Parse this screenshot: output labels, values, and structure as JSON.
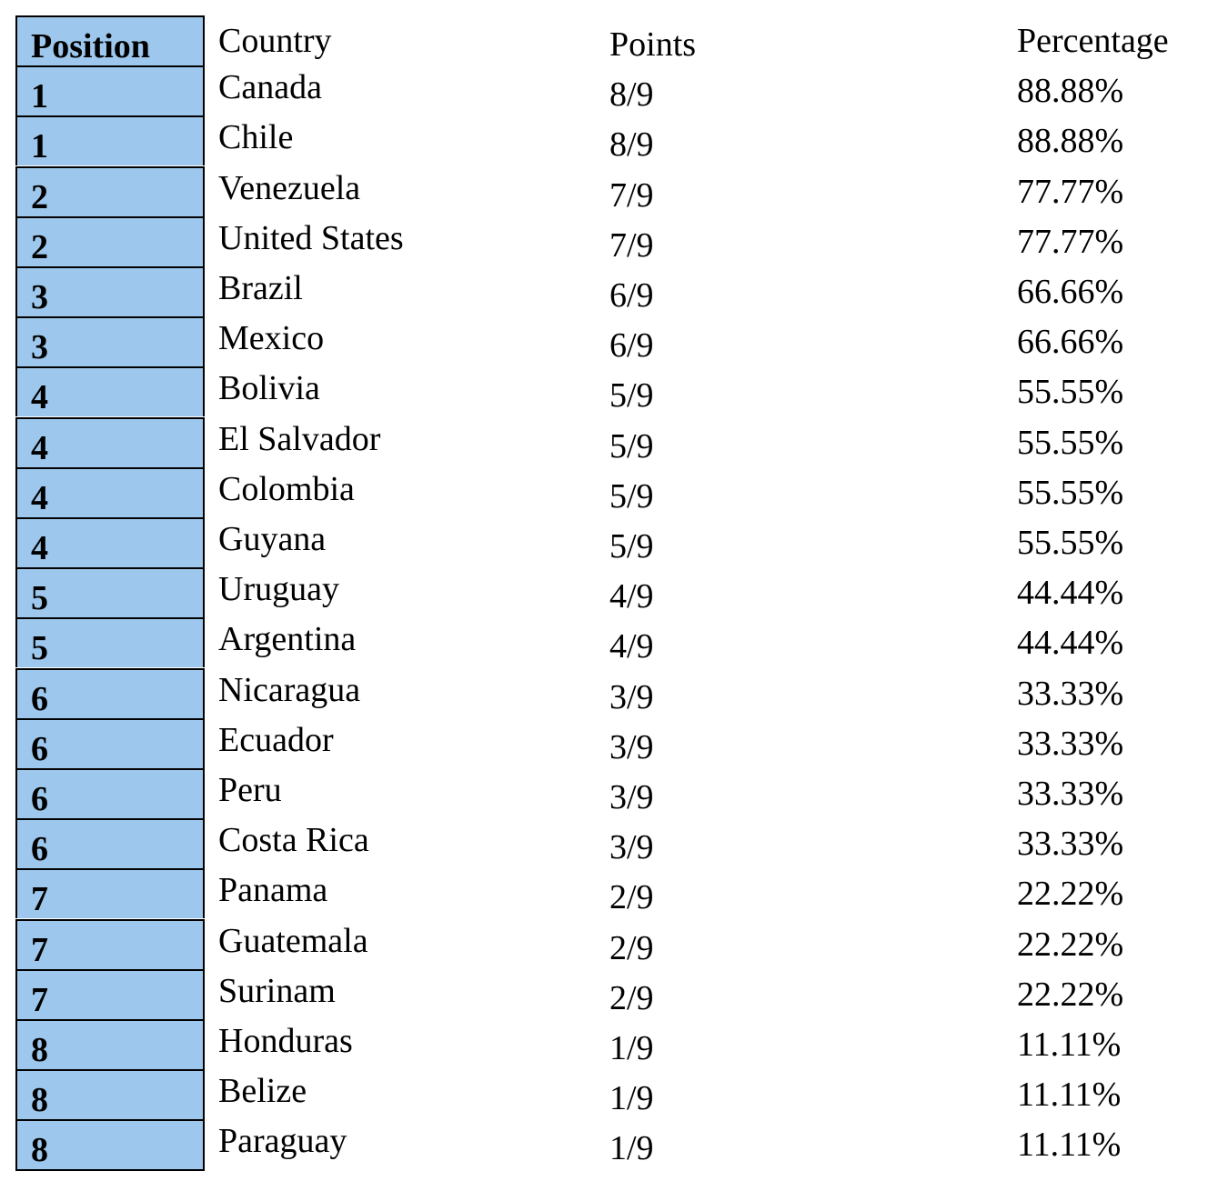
{
  "header": {
    "position": "Position",
    "country": "Country",
    "points": "Points",
    "percentage": "Percentage"
  },
  "rows": [
    {
      "position": "1",
      "country": "Canada",
      "points": "8/9",
      "percentage": "88.88%"
    },
    {
      "position": "1",
      "country": "Chile",
      "points": "8/9",
      "percentage": "88.88%"
    },
    {
      "position": "2",
      "country": "Venezuela",
      "points": "7/9",
      "percentage": "77.77%"
    },
    {
      "position": "2",
      "country": "United States",
      "points": "7/9",
      "percentage": "77.77%"
    },
    {
      "position": "3",
      "country": "Brazil",
      "points": "6/9",
      "percentage": "66.66%"
    },
    {
      "position": "3",
      "country": "Mexico",
      "points": "6/9",
      "percentage": "66.66%"
    },
    {
      "position": "4",
      "country": "Bolivia",
      "points": "5/9",
      "percentage": "55.55%"
    },
    {
      "position": "4",
      "country": "El Salvador",
      "points": "5/9",
      "percentage": "55.55%"
    },
    {
      "position": "4",
      "country": "Colombia",
      "points": "5/9",
      "percentage": "55.55%"
    },
    {
      "position": "4",
      "country": "Guyana",
      "points": "5/9",
      "percentage": "55.55%"
    },
    {
      "position": "5",
      "country": "Uruguay",
      "points": "4/9",
      "percentage": "44.44%"
    },
    {
      "position": "5",
      "country": "Argentina",
      "points": "4/9",
      "percentage": "44.44%"
    },
    {
      "position": "6",
      "country": "Nicaragua",
      "points": "3/9",
      "percentage": "33.33%"
    },
    {
      "position": "6",
      "country": "Ecuador",
      "points": "3/9",
      "percentage": "33.33%"
    },
    {
      "position": "6",
      "country": "Peru",
      "points": "3/9",
      "percentage": "33.33%"
    },
    {
      "position": "6",
      "country": "Costa Rica",
      "points": "3/9",
      "percentage": "33.33%"
    },
    {
      "position": "7",
      "country": "Panama",
      "points": "2/9",
      "percentage": "22.22%"
    },
    {
      "position": "7",
      "country": "Guatemala",
      "points": "2/9",
      "percentage": "22.22%"
    },
    {
      "position": "7",
      "country": "Surinam",
      "points": "2/9",
      "percentage": "22.22%"
    },
    {
      "position": "8",
      "country": "Honduras",
      "points": "1/9",
      "percentage": "11.11%"
    },
    {
      "position": "8",
      "country": "Belize",
      "points": "1/9",
      "percentage": "11.11%"
    },
    {
      "position": "8",
      "country": "Paraguay",
      "points": "1/9",
      "percentage": "11.11%"
    }
  ],
  "colors": {
    "position_fill": "#9DC7EC"
  }
}
